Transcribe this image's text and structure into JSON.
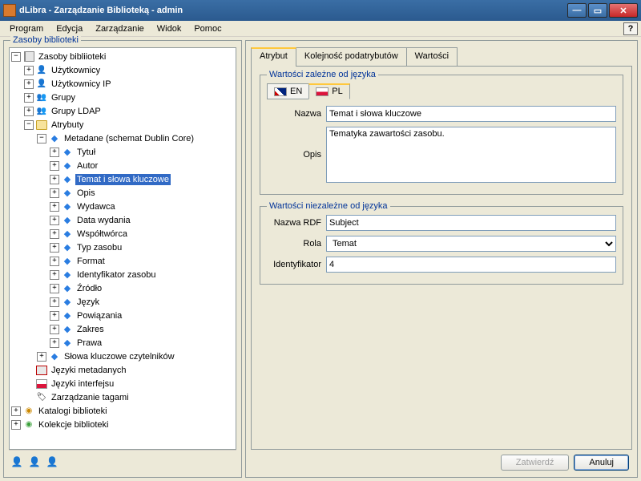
{
  "window": {
    "title": "dLibra - Zarządzanie Biblioteką - admin"
  },
  "menu": {
    "program": "Program",
    "edycja": "Edycja",
    "zarzadzanie": "Zarządzanie",
    "widok": "Widok",
    "pomoc": "Pomoc"
  },
  "left": {
    "title": "Zasoby biblioteki",
    "tree": {
      "root": "Zasoby bibliioteki",
      "uzytk": "Użytkownicy",
      "uzytk_ip": "Użytkownicy IP",
      "grupy": "Grupy",
      "grupy_ldap": "Grupy LDAP",
      "atrybuty": "Atrybuty",
      "metadane": "Metadane (schemat Dublin Core)",
      "tytul": "Tytuł",
      "autor": "Autor",
      "temat": "Temat i słowa kluczowe",
      "opis": "Opis",
      "wydawca": "Wydawca",
      "data_wyd": "Data wydania",
      "wspoltworca": "Współtwórca",
      "typ_zasobu": "Typ zasobu",
      "format": "Format",
      "ident_zasobu": "Identyfikator zasobu",
      "zrodlo": "Źródło",
      "jezyk": "Język",
      "powiazania": "Powiązania",
      "zakres": "Zakres",
      "prawa": "Prawa",
      "slowa_kl": "Słowa kluczowe czytelników",
      "jezyki_meta": "Języki metadanych",
      "jezyki_int": "Języki interfejsu",
      "zarz_tag": "Zarządzanie tagami",
      "katalogi": "Katalogi biblioteki",
      "kolekcje": "Kolekcje biblioteki"
    }
  },
  "right": {
    "tabs": {
      "atrybut": "Atrybut",
      "kolejnosc": "Kolejność podatrybutów",
      "wartosci": "Wartości"
    },
    "fs1": {
      "title": "Wartości zależne od języka",
      "lang_en": "EN",
      "lang_pl": "PL",
      "nazwa_lbl": "Nazwa",
      "nazwa_val": "Temat i słowa kluczowe",
      "opis_lbl": "Opis",
      "opis_val": "Tematyka zawartości zasobu."
    },
    "fs2": {
      "title": "Wartości niezależne od języka",
      "rdf_lbl": "Nazwa RDF",
      "rdf_val": "Subject",
      "rola_lbl": "Rola",
      "rola_val": "Temat",
      "id_lbl": "Identyfikator",
      "id_val": "4"
    },
    "btn_zatw": "Zatwierdź",
    "btn_anul": "Anuluj"
  }
}
